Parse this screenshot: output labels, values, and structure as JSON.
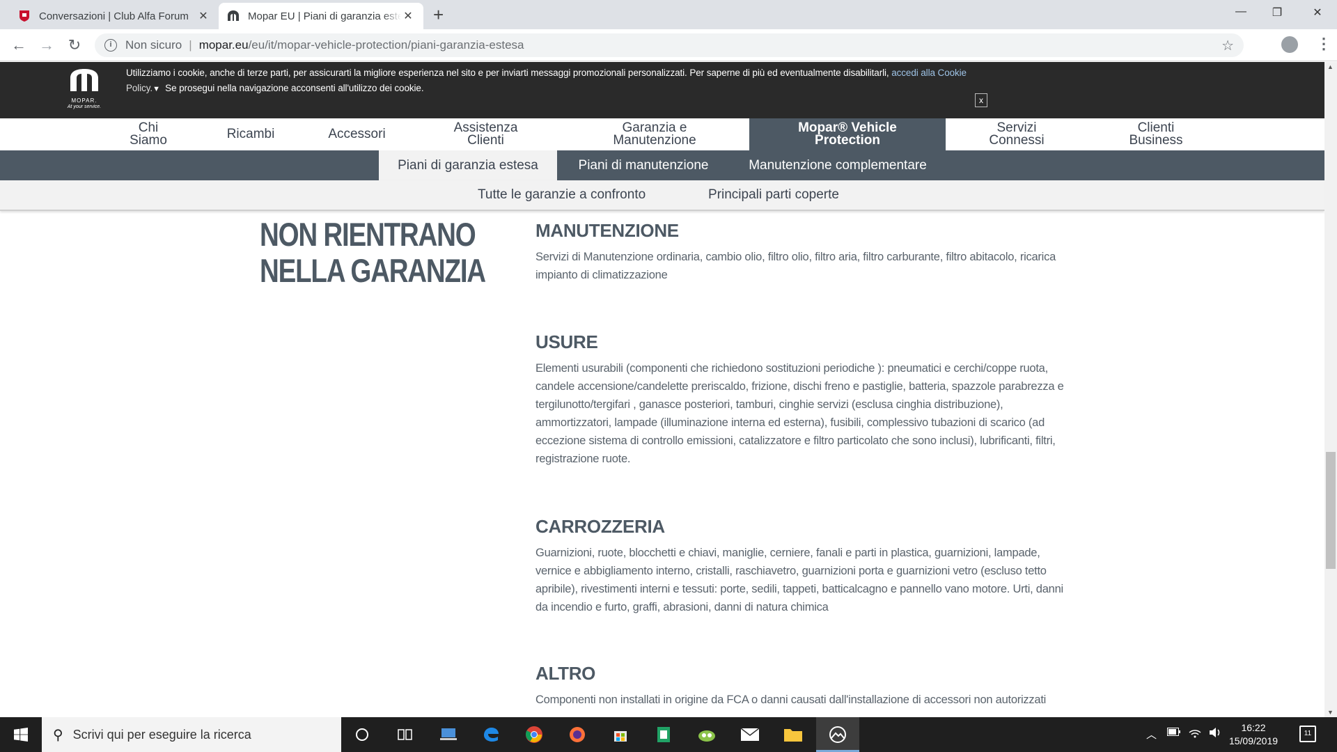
{
  "browser": {
    "tabs": [
      {
        "title": "Conversazioni | Club Alfa Forum",
        "active": false
      },
      {
        "title": "Mopar EU | Piani di garanzia este",
        "active": true
      }
    ],
    "new_tab": "+",
    "window_controls": [
      "—",
      "❐",
      "✕"
    ],
    "back": "←",
    "forward": "→",
    "reload": "↻",
    "address": {
      "security_label": "Non sicuro",
      "separator": "|",
      "host": "mopar.eu",
      "path": "/eu/it/mopar-vehicle-protection/piani-garanzia-estesa"
    },
    "bookmark_star": "☆",
    "menu": "⋮"
  },
  "cookie_banner": {
    "text_line1": "Utilizziamo i cookie, anche di terze parti, per assicurarti la migliore esperienza nel sito e per inviarti messaggi promozionali personalizzati. Per saperne di più ed eventualmente disabilitarli,",
    "link": "accedi alla Cookie",
    "policy": "Policy.",
    "text_line2": "Se prosegui nella navigazione acconsenti all'utilizzo dei cookie.",
    "close": "x"
  },
  "logo": {
    "brand": "MOPAR.",
    "slogan": "At your service."
  },
  "main_nav": [
    {
      "line1": "Chi",
      "line2": "Siamo"
    },
    {
      "line1": "Ricambi",
      "line2": ""
    },
    {
      "line1": "Accessori",
      "line2": ""
    },
    {
      "line1": "Assistenza",
      "line2": "Clienti"
    },
    {
      "line1": "Garanzia e",
      "line2": "Manutenzione"
    },
    {
      "line1": "Mopar® Vehicle",
      "line2": "Protection"
    },
    {
      "line1": "Servizi",
      "line2": "Connessi"
    },
    {
      "line1": "Clienti",
      "line2": "Business"
    }
  ],
  "sub_nav": [
    "Piani di garanzia estesa",
    "Piani di manutenzione",
    "Manutenzione complementare"
  ],
  "tert_nav": [
    "Tutte le garanzie a confronto",
    "Principali parti coperte"
  ],
  "content": {
    "side_title_line1": "NON RIENTRANO",
    "side_title_line2": "NELLA GARANZIA",
    "sections": [
      {
        "heading": "MANUTENZIONE",
        "body": "Servizi di Manutenzione ordinaria, cambio olio, filtro olio, filtro aria, filtro carburante, filtro abitacolo, ricarica impianto di climatizzazione"
      },
      {
        "heading": "USURE",
        "body": "Elementi usurabili (componenti che richiedono sostituzioni periodiche ): pneumatici e cerchi/coppe ruota, candele accensione/candelette preriscaldo, frizione, dischi freno e pastiglie, batteria, spazzole parabrezza e tergilunotto/tergifari , ganasce posteriori, tamburi, cinghie servizi (esclusa cinghia distribuzione), ammortizzatori, lampade (illuminazione interna ed esterna), fusibili, complessivo tubazioni di scarico (ad eccezione sistema di controllo emissioni, catalizzatore e filtro particolato che sono inclusi), lubrificanti, filtri, registrazione ruote."
      },
      {
        "heading": "CARROZZERIA",
        "body": "Guarnizioni, ruote, blocchetti e chiavi, maniglie, cerniere, fanali e parti in plastica, guarnizioni, lampade, vernice e abbigliamento interno, cristalli, raschiavetro, guarnizioni porta e guarnizioni vetro (escluso tetto apribile), rivestimenti interni e tessuti: porte, sedili, tappeti, batticalcagno e pannello vano motore. Urti, danni da incendio e furto, graffi, abrasioni, danni di natura chimica"
      },
      {
        "heading": "ALTRO",
        "body": "Componenti non installati in origine da FCA o danni causati dall'installazione di accessori non autorizzati"
      }
    ]
  },
  "taskbar": {
    "search_placeholder": "Scrivi qui per eseguire la ricerca",
    "time": "16:22",
    "date": "15/09/2019",
    "notifications": "11"
  }
}
